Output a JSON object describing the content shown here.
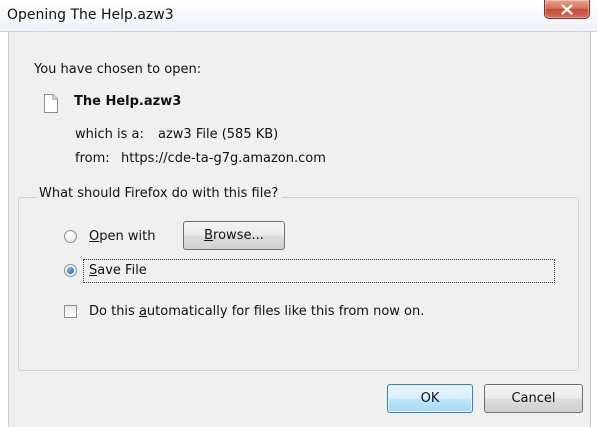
{
  "window": {
    "title": "Opening The Help.azw3",
    "close_icon": "close-icon"
  },
  "intro": {
    "label": "You have chosen to open:",
    "file_icon": "file-icon",
    "file_name": "The Help.azw3",
    "type_label": "which is a:",
    "type_value": "azw3 File (585 KB)",
    "from_label": "from:",
    "from_value": "https://cde-ta-g7g.amazon.com"
  },
  "action_group": {
    "legend": "What should Firefox do with this file?",
    "open_with": {
      "accel": "O",
      "rest": "pen with",
      "checked": false
    },
    "browse": {
      "accel": "B",
      "rest": "rowse..."
    },
    "save_file": {
      "accel": "S",
      "rest": "ave File",
      "checked": true
    },
    "auto": {
      "before": "Do this ",
      "accel": "a",
      "after": "utomatically for files like this from now on.",
      "checked": false
    }
  },
  "buttons": {
    "ok": "OK",
    "cancel": "Cancel"
  },
  "colors": {
    "default_button_border": "#3c7fb1",
    "radio_fill": "#1b5fa6",
    "close_button": "#c84a33"
  }
}
